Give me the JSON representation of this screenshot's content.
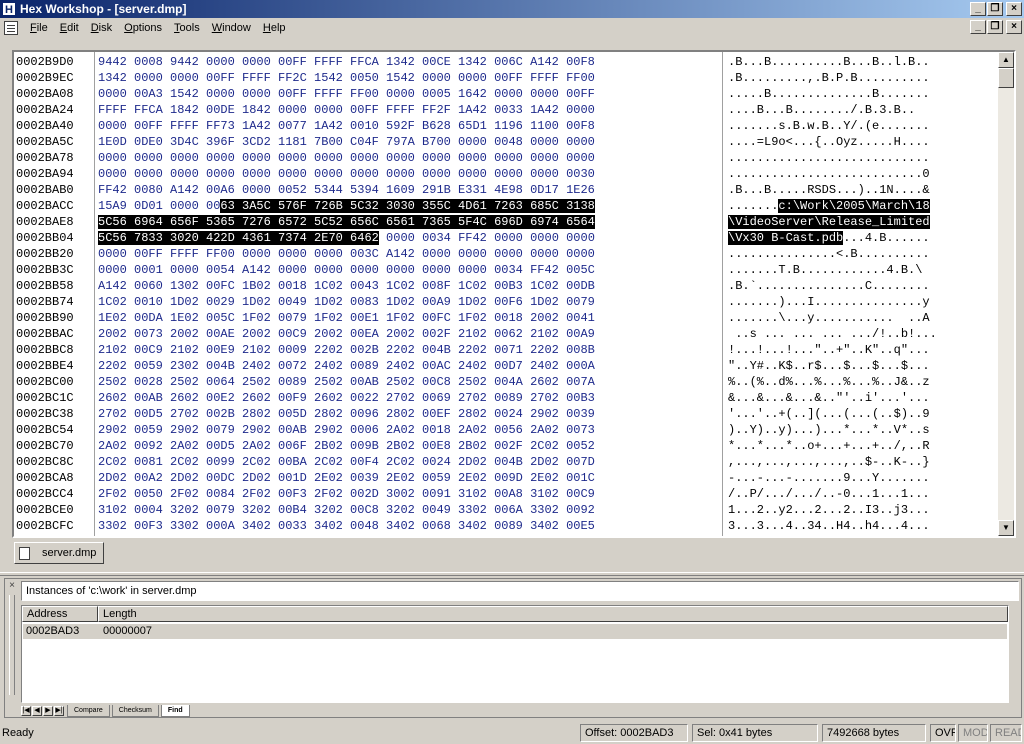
{
  "window": {
    "title": "Hex Workshop - [server.dmp]",
    "app_icon_letter": "H",
    "btn_min": "_",
    "btn_max": "□",
    "btn_close": "×",
    "btn_restore": "❐"
  },
  "menu": [
    "File",
    "Edit",
    "Disk",
    "Options",
    "Tools",
    "Window",
    "Help"
  ],
  "hex_rows": [
    {
      "addr": "0002B9D0",
      "hex": "9442 0008 9442 0000 0000 00FF FFFF FFCA 1342 00CE 1342 006C A142 00F8",
      "ascii": ".B...B..........B...B..l.B.."
    },
    {
      "addr": "0002B9EC",
      "hex": "1342 0000 0000 00FF FFFF FF2C 1542 0050 1542 0000 0000 00FF FFFF FF00",
      "ascii": ".B.........,.B.P.B.........."
    },
    {
      "addr": "0002BA08",
      "hex": "0000 00A3 1542 0000 0000 00FF FFFF FF00 0000 0005 1642 0000 0000 00FF",
      "ascii": ".....B..............B......."
    },
    {
      "addr": "0002BA24",
      "hex": "FFFF FFCA 1842 00DE 1842 0000 0000 00FF FFFF FF2F 1A42 0033 1A42 0000",
      "ascii": "....B...B......../.B.3.B.."
    },
    {
      "addr": "0002BA40",
      "hex": "0000 00FF FFFF FF73 1A42 0077 1A42 0010 592F B628 65D1 1196 1100 00F8",
      "ascii": ".......s.B.w.B..Y/.(e......."
    },
    {
      "addr": "0002BA5C",
      "hex": "1E0D 0DE0 3D4C 396F 3CD2 1181 7B00 C04F 797A B700 0000 0048 0000 0000",
      "ascii": "....=L9o<...{..Oyz.....H...."
    },
    {
      "addr": "0002BA78",
      "hex": "0000 0000 0000 0000 0000 0000 0000 0000 0000 0000 0000 0000 0000 0000",
      "ascii": "............................"
    },
    {
      "addr": "0002BA94",
      "hex": "0000 0000 0000 0000 0000 0000 0000 0000 0000 0000 0000 0000 0000 0030",
      "ascii": "...........................0"
    },
    {
      "addr": "0002BAB0",
      "hex": "FF42 0080 A142 00A6 0000 0052 5344 5394 1609 291B E331 4E98 0D17 1E26",
      "ascii": ".B...B.....RSDS...)..1N....&"
    },
    {
      "addr": "0002BACC",
      "hex_pre": "15A9 0D01 0000 00",
      "hex_sel": "63 3A5C 576F 726B 5C32 3030 355C 4D61 7263 685C 3138",
      "ascii_pre": ".......",
      "ascii_sel": "c:\\Work\\2005\\March\\18"
    },
    {
      "addr": "0002BAE8",
      "hex_sel": "5C56 6964 656F 5365 7276 6572 5C52 656C 6561 7365 5F4C 696D 6974 6564",
      "ascii_sel": "\\VideoServer\\Release_Limited"
    },
    {
      "addr": "0002BB04",
      "hex_sel": "5C56 7833 3020 422D 4361 7374 2E70 6462",
      "hex_post": " 0000 0034 FF42 0000 0000 0000",
      "ascii_sel": "\\Vx30 B-Cast.pdb",
      "ascii_post": "...4.B......"
    },
    {
      "addr": "0002BB20",
      "hex": "0000 00FF FFFF FF00 0000 0000 0000 003C A142 0000 0000 0000 0000 0000",
      "ascii": "...............<.B.........."
    },
    {
      "addr": "0002BB3C",
      "hex": "0000 0001 0000 0054 A142 0000 0000 0000 0000 0000 0000 0034 FF42 005C",
      "ascii": ".......T.B............4.B.\\"
    },
    {
      "addr": "0002BB58",
      "hex": "A142 0060 1302 00FC 1B02 0018 1C02 0043 1C02 008F 1C02 00B3 1C02 00DB",
      "ascii": ".B.`...............C........"
    },
    {
      "addr": "0002BB74",
      "hex": "1C02 0010 1D02 0029 1D02 0049 1D02 0083 1D02 00A9 1D02 00F6 1D02 0079",
      "ascii": ".......)...I...............y"
    },
    {
      "addr": "0002BB90",
      "hex": "1E02 00DA 1E02 005C 1F02 0079 1F02 00E1 1F02 00FC 1F02 0018 2002 0041",
      "ascii": ".......\\...y...........  ..A"
    },
    {
      "addr": "0002BBAC",
      "hex": "2002 0073 2002 00AE 2002 00C9 2002 00EA 2002 002F 2102 0062 2102 00A9",
      "ascii": " ..s ... ... ... .../!..b!..."
    },
    {
      "addr": "0002BBC8",
      "hex": "2102 00C9 2102 00E9 2102 0009 2202 002B 2202 004B 2202 0071 2202 008B",
      "ascii": "!...!...!...\"..+\"..K\"..q\"..."
    },
    {
      "addr": "0002BBE4",
      "hex": "2202 0059 2302 004B 2402 0072 2402 0089 2402 00AC 2402 00D7 2402 000A",
      "ascii": "\"..Y#..K$..r$...$...$...$..."
    },
    {
      "addr": "0002BC00",
      "hex": "2502 0028 2502 0064 2502 0089 2502 00AB 2502 00C8 2502 004A 2602 007A",
      "ascii": "%..(%..d%...%...%...%..J&..z"
    },
    {
      "addr": "0002BC1C",
      "hex": "2602 00AB 2602 00E2 2602 00F9 2602 0022 2702 0069 2702 0089 2702 00B3",
      "ascii": "&...&...&...&..\"'..i'...'..."
    },
    {
      "addr": "0002BC38",
      "hex": "2702 00D5 2702 002B 2802 005D 2802 0096 2802 00EF 2802 0024 2902 0039",
      "ascii": "'...'..+(..](...(...(..$)..9"
    },
    {
      "addr": "0002BC54",
      "hex": "2902 0059 2902 0079 2902 00AB 2902 0006 2A02 0018 2A02 0056 2A02 0073",
      "ascii": ")..Y)..y)...)...*...*..V*..s"
    },
    {
      "addr": "0002BC70",
      "hex": "2A02 0092 2A02 00D5 2A02 006F 2B02 009B 2B02 00E8 2B02 002F 2C02 0052",
      "ascii": "*...*...*..o+...+...+../,..R"
    },
    {
      "addr": "0002BC8C",
      "hex": "2C02 0081 2C02 0099 2C02 00BA 2C02 00F4 2C02 0024 2D02 004B 2D02 007D",
      "ascii": ",...,...,...,...,..$-..K-..}"
    },
    {
      "addr": "0002BCA8",
      "hex": "2D02 00A2 2D02 00DC 2D02 001D 2E02 0039 2E02 0059 2E02 009D 2E02 001C",
      "ascii": "-...-...-.......9...Y......."
    },
    {
      "addr": "0002BCC4",
      "hex": "2F02 0050 2F02 0084 2F02 00F3 2F02 002D 3002 0091 3102 00A8 3102 00C9",
      "ascii": "/..P/.../.../..-0...1...1..."
    },
    {
      "addr": "0002BCE0",
      "hex": "3102 0004 3202 0079 3202 00B4 3202 00C8 3202 0049 3302 006A 3302 0092",
      "ascii": "1...2..y2...2...2..I3..j3..."
    },
    {
      "addr": "0002BCFC",
      "hex": "3302 00F3 3302 000A 3402 0033 3402 0048 3402 0068 3402 0089 3402 00E5",
      "ascii": "3...3...4..34..H4..h4...4..."
    }
  ],
  "doc_tab": "server.dmp",
  "results": {
    "title": "Instances of 'c:\\work' in server.dmp",
    "col_address": "Address",
    "col_length": "Length",
    "rows": [
      {
        "address": "0002BAD3",
        "length": "00000007"
      }
    ],
    "tabs": [
      "Compare",
      "Checksum",
      "Find"
    ],
    "panel_close": "×"
  },
  "status": {
    "ready": "Ready",
    "offset": "Offset: 0002BAD3",
    "sel": "Sel: 0x41 bytes",
    "size": "7492668 bytes",
    "ovr": "OVR",
    "mod": "MOD",
    "read": "READ"
  }
}
